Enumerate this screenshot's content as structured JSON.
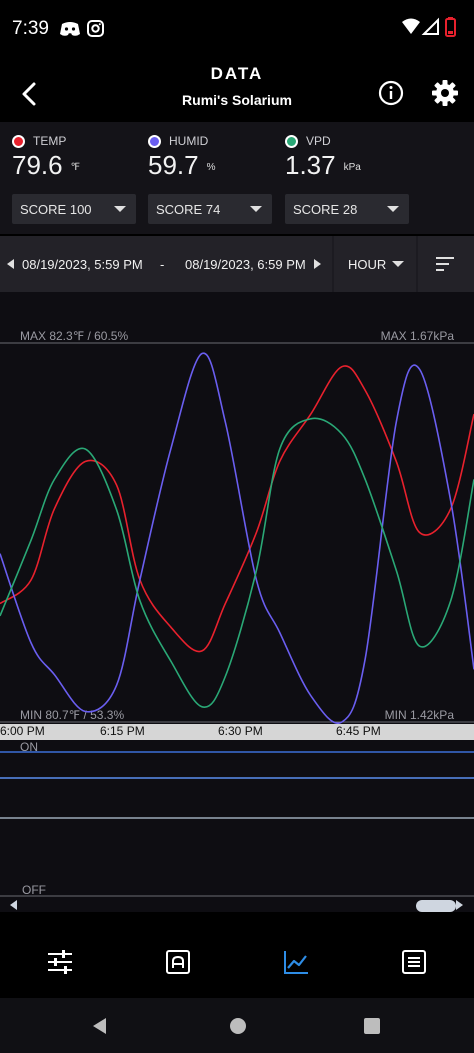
{
  "status_bar": {
    "time": "7:39",
    "left_icons": [
      "discord-icon",
      "instagram-icon"
    ],
    "right_icons": [
      "wifi-icon",
      "signal-icon",
      "battery-low-icon"
    ]
  },
  "header": {
    "title": "DATA",
    "subtitle": "Rumi's Solarium"
  },
  "metrics": [
    {
      "label": "TEMP",
      "value": "79.6",
      "unit": "℉",
      "color": "#e8212d",
      "score": "SCORE 100"
    },
    {
      "label": "HUMID",
      "value": "59.7",
      "unit": "%",
      "color": "#6a5ef0",
      "score": "SCORE 74"
    },
    {
      "label": "VPD",
      "value": "1.37",
      "unit": "kPa",
      "color": "#2aa876",
      "score": "SCORE 28"
    }
  ],
  "range": {
    "start": "08/19/2023, 5:59 PM",
    "separator": "-",
    "end": "08/19/2023, 6:59 PM",
    "interval": "HOUR"
  },
  "chart": {
    "max_left": "MAX 82.3℉ / 60.5%",
    "max_right": "MAX 1.67kPa",
    "min_left": "MIN 80.7℉ / 53.3%",
    "min_right": "MIN 1.42kPa",
    "time_ticks": [
      "6:00 PM",
      "6:15 PM",
      "6:30 PM",
      "6:45 PM"
    ],
    "on_label": "ON",
    "off_label": "OFF"
  },
  "chart_data": {
    "type": "line",
    "x_minutes_after_6pm": [
      -1,
      3,
      6,
      10,
      14,
      17,
      21,
      25,
      28,
      32,
      35,
      39,
      43,
      46,
      50,
      53,
      57,
      60
    ],
    "series": [
      {
        "name": "TEMP",
        "unit": "℉",
        "color": "#e8212d",
        "values": [
          81.2,
          81.3,
          81.6,
          81.8,
          81.7,
          81.3,
          81.1,
          81.0,
          81.2,
          81.5,
          81.8,
          82.0,
          82.2,
          82.1,
          81.8,
          81.5,
          81.6,
          82.0
        ]
      },
      {
        "name": "HUMID",
        "unit": "%",
        "color": "#6a5ef0",
        "values": [
          56.5,
          54.8,
          54.2,
          53.5,
          54.0,
          56.0,
          58.5,
          60.3,
          59.0,
          56.0,
          55.0,
          53.8,
          53.3,
          54.5,
          59.0,
          60.0,
          57.5,
          54.3
        ]
      },
      {
        "name": "VPD",
        "unit": "kPa",
        "color": "#2aa876",
        "values": [
          1.49,
          1.54,
          1.58,
          1.6,
          1.56,
          1.5,
          1.46,
          1.43,
          1.45,
          1.52,
          1.6,
          1.62,
          1.61,
          1.58,
          1.52,
          1.47,
          1.5,
          1.58
        ]
      }
    ],
    "ylim_left": [
      80.7,
      82.3
    ],
    "ylim_humid": [
      53.3,
      60.5
    ],
    "ylim_right": [
      1.42,
      1.67
    ]
  },
  "onoff_lines": [
    {
      "color": "#3b6fd8",
      "state": "ON"
    },
    {
      "color": "#5a8ef0",
      "state": "ON"
    },
    {
      "color": "#b8c8d8",
      "state": "ON"
    }
  ],
  "bottom_nav": [
    "sliders-icon",
    "controller-icon",
    "chart-line-icon",
    "list-icon"
  ],
  "accent": "#2e8de6"
}
